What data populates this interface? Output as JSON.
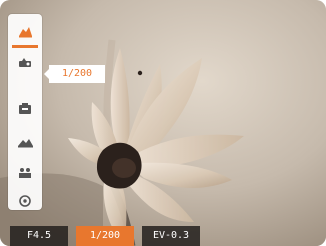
{
  "sidebar": {
    "items": [
      {
        "icon": "scene-mode-icon",
        "selected": true
      },
      {
        "icon": "flash-mode-icon",
        "selected": false
      },
      {
        "icon": "timer-mode-icon",
        "selected": false
      },
      {
        "icon": "landscape-mode-icon",
        "selected": false
      },
      {
        "icon": "portrait-mode-icon",
        "selected": false
      },
      {
        "icon": "settings-mode-icon",
        "selected": false
      }
    ]
  },
  "tooltip": {
    "text": "1/200"
  },
  "status": {
    "aperture": "F4.5",
    "shutter": "1/200",
    "ev": "EV-0.3"
  },
  "colors": {
    "accent": "#e8772e",
    "panel": "#ffffff",
    "status_bg": "#23201d"
  }
}
